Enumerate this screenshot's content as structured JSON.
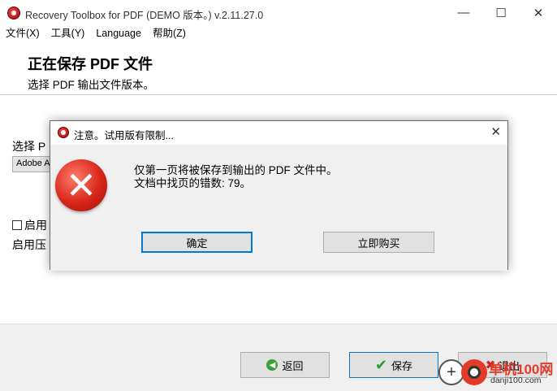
{
  "window": {
    "title": "Recovery Toolbox for PDF (DEMO 版本。) v.2.11.27.0",
    "min_glyph": "—",
    "max_glyph": "☐",
    "close_glyph": "✕"
  },
  "menu": [
    "文件(X)",
    "工具(Y)",
    "Language",
    "帮助(Z)"
  ],
  "header": {
    "title": "正在保存 PDF 文件",
    "subtitle": "选择 PDF 输出文件版本。"
  },
  "content": {
    "select_label": "选择 P",
    "version_value": "Adobe A",
    "enable_label": "启用",
    "compress_label": "启用压"
  },
  "footer": {
    "back_label": "返回",
    "save_label": "保存",
    "exit_label": "退出"
  },
  "watermark": {
    "plus_glyph": "+",
    "brand": "单机100网",
    "url": "danji100.com"
  },
  "dialog": {
    "title": "注意。试用版有限制...",
    "close_glyph": "✕",
    "error_glyph": "✕",
    "message_line1": "仅第一页将被保存到输出的 PDF 文件中。",
    "message_line2": "文档中找页的错数: 79。",
    "ok_label": "确定",
    "buy_label": "立即购买"
  },
  "colors": {
    "accent_border": "#0078d7",
    "error_red": "#d8261a"
  }
}
